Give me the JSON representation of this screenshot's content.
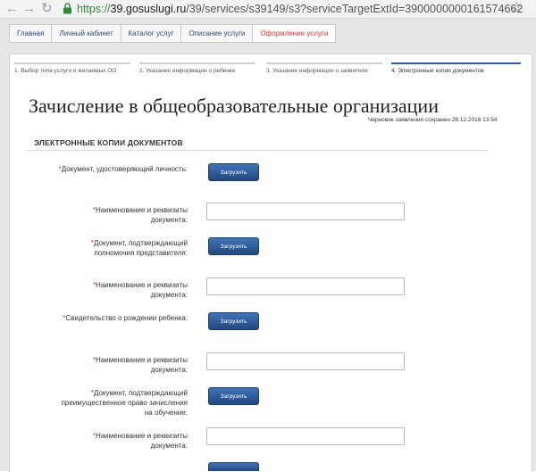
{
  "browser": {
    "url_scheme": "https://",
    "url_host": "39.gosuslugi.ru",
    "url_path": "/39/services/s39149/s3?serviceTargetExtId=3900000000161574662"
  },
  "breadcrumb": [
    {
      "label": "Главная"
    },
    {
      "label": "Личный кабинет"
    },
    {
      "label": "Каталог услуг"
    },
    {
      "label": "Описание услуги"
    },
    {
      "label": "Оформление услуги"
    }
  ],
  "steps": [
    {
      "label": "1. Выбор типа услуги и желаемых ОО"
    },
    {
      "label": "2. Указание информации о ребенке"
    },
    {
      "label": "3. Указание информации о заявителе"
    },
    {
      "label": "4. Электронные копии документов"
    }
  ],
  "title": "Зачисление в общеобразовательные организации",
  "draft_status": "Черновик заявления сохранен 28.12.2016 13:54",
  "section_title": "ЭЛЕКТРОННЫЕ КОПИИ ДОКУМЕНТОВ",
  "required_mark": "*",
  "upload_label": "Загрузить",
  "fields": {
    "doc_identity": [
      "Документ, удостоверяющий личность:"
    ],
    "doc_identity_name": [
      "Наименование и реквизиты",
      "документа:"
    ],
    "doc_authority": [
      "Документ, подтверждающий",
      "полномочия представителя:"
    ],
    "doc_authority_name": [
      "Наименование и реквизиты",
      "документа:"
    ],
    "doc_birth": [
      "Свидетельство о рождении ребенка:"
    ],
    "doc_birth_name": [
      "Наименование и реквизиты",
      "документа:"
    ],
    "doc_priority": [
      "Документ, подтверждающий",
      "преимущественное право зачисления",
      "на обучение:"
    ],
    "doc_priority_name": [
      "Наименование и реквизиты",
      "документа:"
    ]
  }
}
